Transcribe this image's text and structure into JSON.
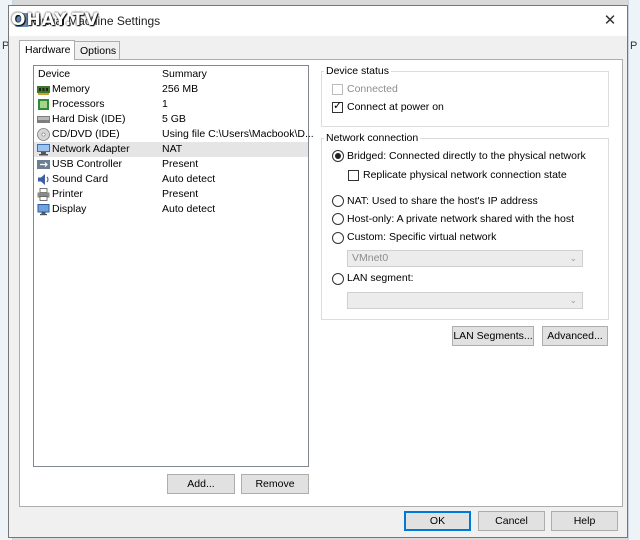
{
  "background": {
    "left_letter": "P",
    "right_letter": "P"
  },
  "window": {
    "title": "Virtual Machine Settings",
    "watermark": "OHAY.TV",
    "close_glyph": "✕"
  },
  "tabs": [
    {
      "label": "Hardware",
      "active": true
    },
    {
      "label": "Options",
      "active": false
    }
  ],
  "device_list": {
    "headers": {
      "device": "Device",
      "summary": "Summary"
    },
    "rows": [
      {
        "device": "Memory",
        "summary": "256 MB",
        "icon": "memory-icon",
        "selected": false
      },
      {
        "device": "Processors",
        "summary": "1",
        "icon": "processor-icon",
        "selected": false
      },
      {
        "device": "Hard Disk (IDE)",
        "summary": "5 GB",
        "icon": "hard-disk-icon",
        "selected": false
      },
      {
        "device": "CD/DVD (IDE)",
        "summary": "Using file C:\\Users\\Macbook\\D...",
        "icon": "cd-dvd-icon",
        "selected": false
      },
      {
        "device": "Network Adapter",
        "summary": "NAT",
        "icon": "network-adapter-icon",
        "selected": true
      },
      {
        "device": "USB Controller",
        "summary": "Present",
        "icon": "usb-icon",
        "selected": false
      },
      {
        "device": "Sound Card",
        "summary": "Auto detect",
        "icon": "sound-card-icon",
        "selected": false
      },
      {
        "device": "Printer",
        "summary": "Present",
        "icon": "printer-icon",
        "selected": false
      },
      {
        "device": "Display",
        "summary": "Auto detect",
        "icon": "display-icon",
        "selected": false
      }
    ]
  },
  "list_buttons": {
    "add": "Add...",
    "remove": "Remove"
  },
  "device_status": {
    "title": "Device status",
    "connected": {
      "label": "Connected",
      "checked": false,
      "enabled": false
    },
    "connect_at_power_on": {
      "label": "Connect at power on",
      "checked": true,
      "enabled": true
    }
  },
  "network_connection": {
    "title": "Network connection",
    "bridged": {
      "label": "Bridged: Connected directly to the physical network",
      "selected": true
    },
    "replicate": {
      "label": "Replicate physical network connection state",
      "checked": false
    },
    "nat": {
      "label": "NAT: Used to share the host's IP address",
      "selected": false
    },
    "host_only": {
      "label": "Host-only: A private network shared with the host",
      "selected": false
    },
    "custom": {
      "label": "Custom: Specific virtual network",
      "selected": false
    },
    "custom_combo_value": "VMnet0",
    "lan_segment": {
      "label": "LAN segment:",
      "selected": false
    },
    "lan_combo_value": ""
  },
  "panel_buttons": {
    "lan_segments": "LAN Segments...",
    "advanced": "Advanced..."
  },
  "dialog_buttons": {
    "ok": "OK",
    "cancel": "Cancel",
    "help": "Help"
  },
  "glyphs": {
    "check": "✓",
    "dropdown": "⌄"
  },
  "colors": {
    "selection": "#e5e5e5",
    "focus_border": "#0078d7",
    "disabled_text": "#8d8d8d"
  }
}
